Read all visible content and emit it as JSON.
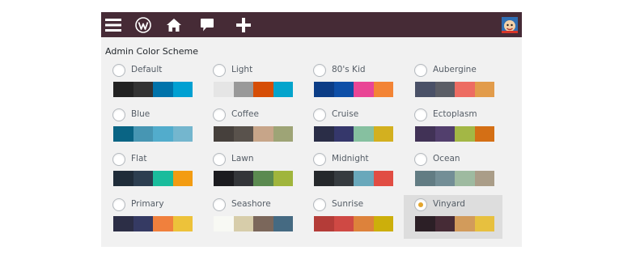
{
  "toolbar": {
    "icons": [
      "menu-icon",
      "wordpress-logo-icon",
      "home-icon",
      "comment-icon",
      "plus-icon",
      "user-avatar-icon"
    ],
    "background": "#462b36"
  },
  "section_title": "Admin Color Scheme",
  "accent": "#e4a52d",
  "schemes": [
    {
      "label": "Default",
      "selected": false,
      "colors": [
        "#222222",
        "#333333",
        "#0073aa",
        "#00a0d2"
      ]
    },
    {
      "label": "Light",
      "selected": false,
      "colors": [
        "#e5e5e5",
        "#999999",
        "#d64e07",
        "#04a4cc"
      ]
    },
    {
      "label": "80's Kid",
      "selected": false,
      "colors": [
        "#0c3d86",
        "#0e4fa7",
        "#e94595",
        "#f38435"
      ]
    },
    {
      "label": "Aubergine",
      "selected": false,
      "colors": [
        "#4a5167",
        "#5b5e66",
        "#ed6c62",
        "#e29c4b"
      ]
    },
    {
      "label": "Blue",
      "selected": false,
      "colors": [
        "#096484",
        "#4796b3",
        "#52accc",
        "#74b6ce"
      ]
    },
    {
      "label": "Coffee",
      "selected": false,
      "colors": [
        "#46403c",
        "#59524c",
        "#c7a589",
        "#9ea476"
      ]
    },
    {
      "label": "Cruise",
      "selected": false,
      "colors": [
        "#2a2d47",
        "#35376b",
        "#86c0a0",
        "#d3b01f"
      ]
    },
    {
      "label": "Ectoplasm",
      "selected": false,
      "colors": [
        "#413256",
        "#523f6d",
        "#a3b745",
        "#d46f15"
      ]
    },
    {
      "label": "Flat",
      "selected": false,
      "colors": [
        "#1f2c39",
        "#2c3e50",
        "#1abc9c",
        "#f39c12"
      ]
    },
    {
      "label": "Lawn",
      "selected": false,
      "colors": [
        "#1b1b1f",
        "#333539",
        "#5b8a50",
        "#a0b53c"
      ]
    },
    {
      "label": "Midnight",
      "selected": false,
      "colors": [
        "#25282b",
        "#363b3f",
        "#69a8bb",
        "#e14d43"
      ]
    },
    {
      "label": "Ocean",
      "selected": false,
      "colors": [
        "#627c83",
        "#738e96",
        "#9ebaa0",
        "#aa9d88"
      ]
    },
    {
      "label": "Primary",
      "selected": false,
      "colors": [
        "#2c2e46",
        "#353a63",
        "#f0803d",
        "#edc23a"
      ]
    },
    {
      "label": "Seashore",
      "selected": false,
      "colors": [
        "#f8f9f4",
        "#d7cdaa",
        "#7b675b",
        "#456a82"
      ]
    },
    {
      "label": "Sunrise",
      "selected": false,
      "colors": [
        "#b43c38",
        "#cf4944",
        "#dd823b",
        "#ccaf0b"
      ]
    },
    {
      "label": "Vinyard",
      "selected": true,
      "colors": [
        "#2c1f26",
        "#462b36",
        "#d29b5b",
        "#e7c03f"
      ]
    }
  ]
}
